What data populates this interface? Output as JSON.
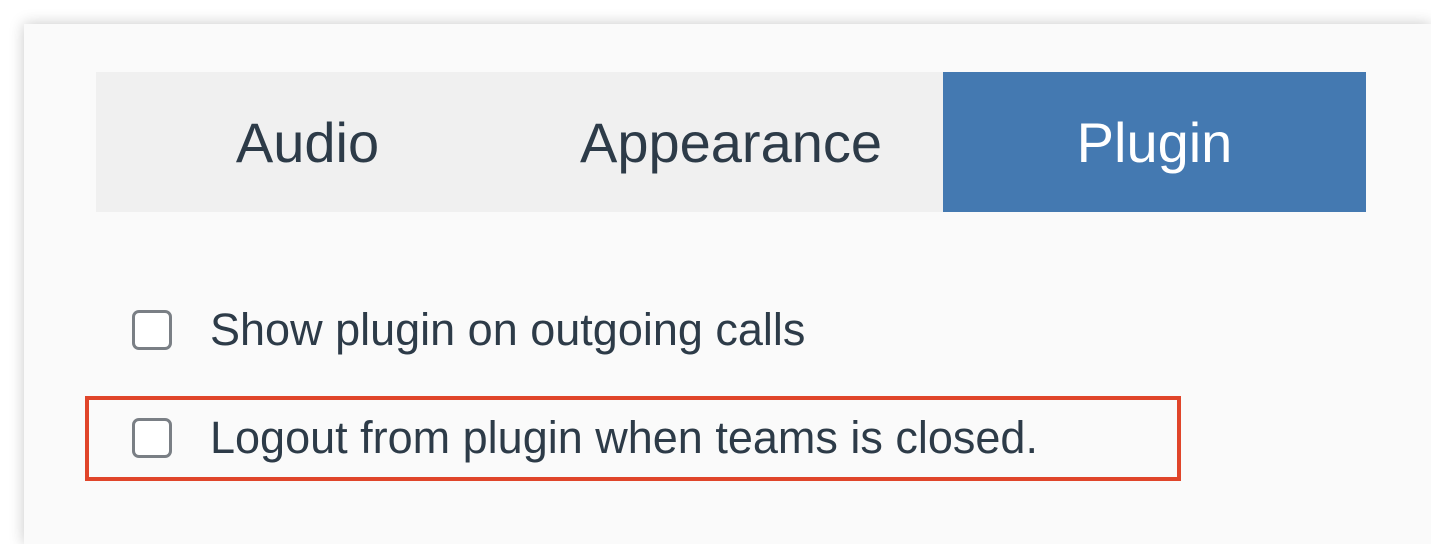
{
  "tabs": {
    "audio": "Audio",
    "appearance": "Appearance",
    "plugin": "Plugin",
    "active": "Plugin"
  },
  "options": {
    "show_plugin": {
      "label": "Show plugin on outgoing calls",
      "checked": false
    },
    "logout_plugin": {
      "label": "Logout from plugin when teams is closed.",
      "checked": false
    }
  },
  "colors": {
    "active_tab": "#4479b1",
    "tabbar_bg": "#f0f0f0",
    "highlight": "#e0452a",
    "text": "#2d3b48"
  }
}
